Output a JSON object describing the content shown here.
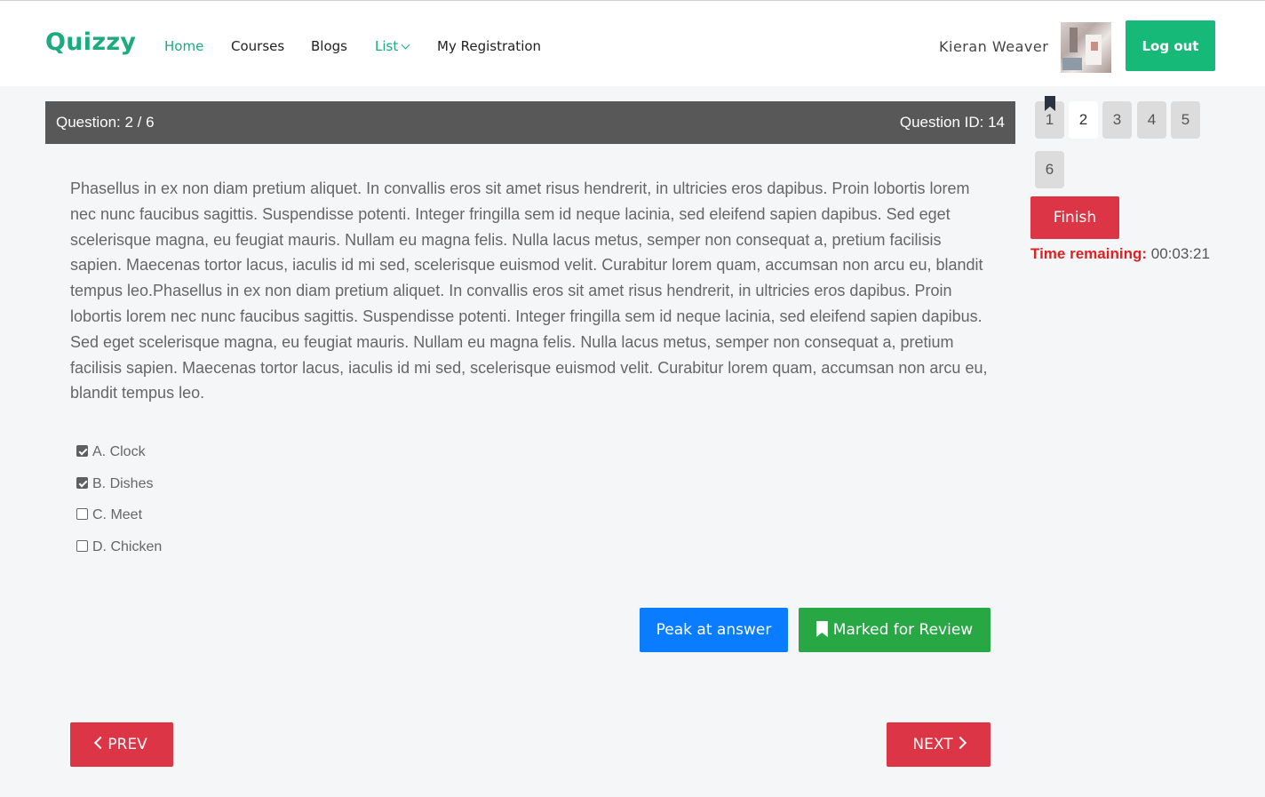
{
  "app": {
    "logo": "Quizzy"
  },
  "nav": {
    "home": "Home",
    "courses": "Courses",
    "blogs": "Blogs",
    "list": "List",
    "my_registration": "My Registration"
  },
  "user": {
    "name": "Kieran Weaver",
    "logout_label": "Log out"
  },
  "question": {
    "counter": "Question: 2 / 6",
    "id_label": "Question ID: 14",
    "text": "Phasellus in ex non diam pretium aliquet. In convallis eros sit amet risus hendrerit, in ultricies eros dapibus. Proin lobortis lorem nec nunc faucibus sagittis. Suspendisse potenti. Integer fringilla sem id neque lacinia, sed eleifend sapien dapibus. Sed eget scelerisque magna, eu feugiat mauris. Nullam eu magna felis. Nulla lacus metus, semper non consequat a, pretium facilisis sapien. Maecenas tortor lacus, iaculis id mi sed, scelerisque euismod velit. Curabitur lorem quam, accumsan non arcu eu, blandit tempus leo.Phasellus in ex non diam pretium aliquet. In convallis eros sit amet risus hendrerit, in ultricies eros dapibus. Proin lobortis lorem nec nunc faucibus sagittis. Suspendisse potenti. Integer fringilla sem id neque lacinia, sed eleifend sapien dapibus. Sed eget scelerisque magna, eu feugiat mauris. Nullam eu magna felis. Nulla lacus metus, semper non consequat a, pretium facilisis sapien. Maecenas tortor lacus, iaculis id mi sed, scelerisque euismod velit. Curabitur lorem quam, accumsan non arcu eu, blandit tempus leo."
  },
  "options": [
    {
      "label": "A. Clock",
      "checked": true
    },
    {
      "label": "B. Dishes",
      "checked": true
    },
    {
      "label": "C. Meet",
      "checked": false
    },
    {
      "label": "D. Chicken",
      "checked": false
    }
  ],
  "actions": {
    "peak": "Peak at answer",
    "review": "Marked for Review",
    "prev": "PREV",
    "next": "NEXT",
    "finish": "Finish"
  },
  "palette": [
    {
      "num": "1",
      "flagged": true,
      "current": false
    },
    {
      "num": "2",
      "flagged": false,
      "current": true
    },
    {
      "num": "3",
      "flagged": false,
      "current": false
    },
    {
      "num": "4",
      "flagged": false,
      "current": false
    },
    {
      "num": "5",
      "flagged": false,
      "current": false
    },
    {
      "num": "6",
      "flagged": false,
      "current": false
    }
  ],
  "timer": {
    "label": "Time remaining:",
    "value": "00:03:21"
  },
  "colors": {
    "brand": "#1aab7e",
    "logout": "#17b978",
    "danger": "#dc3545",
    "primary": "#0a7cff",
    "success": "#28a745",
    "header_bar": "#585858"
  },
  "icons": {
    "list_dropdown": "chevron-down-icon",
    "review": "bookmark-icon",
    "flag": "bookmark-flag-icon",
    "prev": "chevron-left-icon",
    "next": "chevron-right-icon"
  }
}
